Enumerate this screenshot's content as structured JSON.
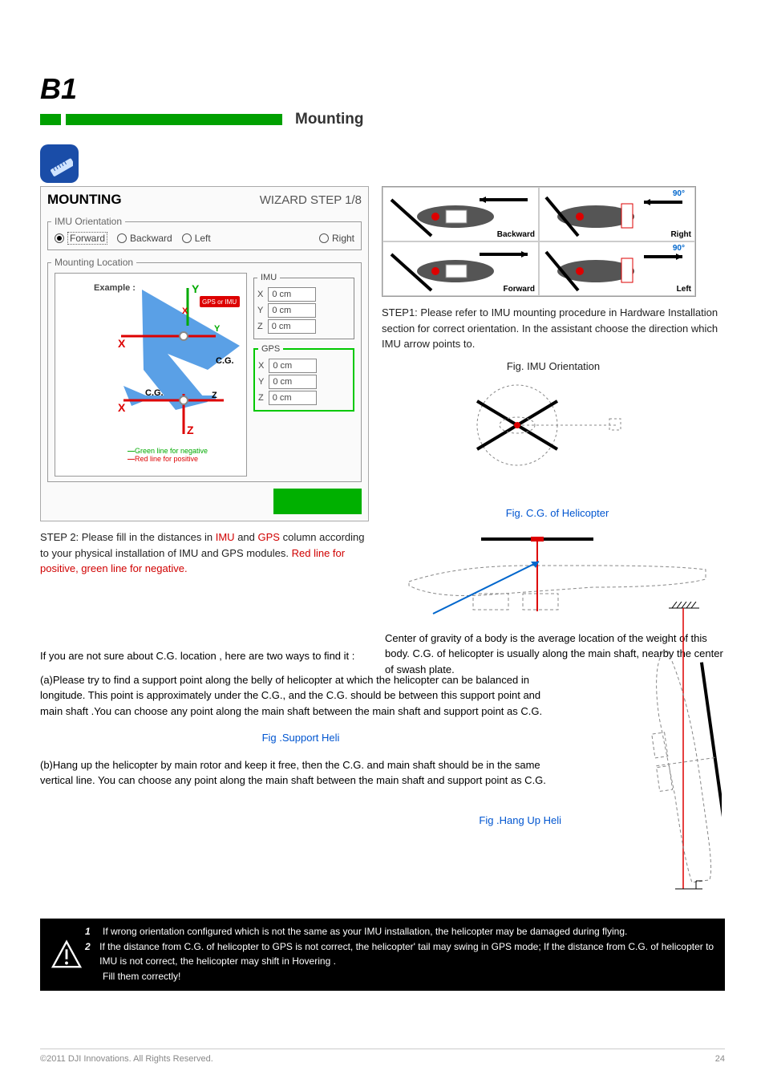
{
  "section": {
    "id": "B1",
    "title": "Mounting"
  },
  "mounting_panel": {
    "title": "MOUNTING",
    "wizard": "WIZARD STEP 1/8",
    "orientation_group": "IMU Orientation",
    "orientation_options": [
      "Forward",
      "Backward",
      "Left",
      "Right"
    ],
    "orientation_selected": "Forward",
    "location_group": "Mounting Location",
    "example": {
      "label": "Example :",
      "tag": "GPS or IMU",
      "cg": "C.G.",
      "neg_line": "Green line for negative",
      "pos_line": "Red line for positive"
    },
    "imu_group": "IMU",
    "gps_group": "GPS",
    "fields": {
      "x_label": "X",
      "x_val": "0 cm",
      "y_label": "Y",
      "y_val": "0 cm",
      "z_label": "Z",
      "z_val": "0 cm"
    }
  },
  "orientation_images": {
    "deg": "90°",
    "backward": "Backward",
    "right": "Right",
    "forward": "Forward",
    "left": "Left"
  },
  "step1": {
    "text": "STEP1: Please refer to IMU mounting procedure in Hardware Installation section for correct orientation. In the assistant choose the direction which IMU arrow points to.",
    "figure_caption": "Fig. IMU Orientation"
  },
  "step2": {
    "lead": "STEP 2: Please fill in the distances in",
    "imu_word": "IMU",
    "gps_word": "GPS",
    "tail": "column according to your physical installation of IMU and GPS modules.",
    "note": "Red line for positive, green line for negative.",
    "fig_cap_cg": "Fig. C.G. of Helicopter",
    "cg_para": "Center of gravity of a body is the average location of the weight of this body. C.G. of helicopter is usually along the main shaft, nearby the center of swash plate."
  },
  "support": {
    "title": "If you are not sure about C.G. location , here are two ways to find it :",
    "a": "(a)Please try to find a support point along the belly of helicopter at which the helicopter can be balanced in longitude. This point is approximately under the C.G., and the C.G. should be between this support point and main shaft .You can choose any point along the main shaft between the main shaft and support point as C.G.",
    "b": "(b)Hang up the helicopter by main rotor and keep it free, then the C.G. and main shaft should be in the same vertical line. You can choose any point along the main shaft between the main shaft and support point as C.G.",
    "fig_support": "Fig .Support Heli",
    "fig_hang": "Fig .Hang Up Heli"
  },
  "warning": {
    "row1": "If wrong orientation configured which is not the same as your IMU installation, the helicopter may be damaged during flying.",
    "row2_a": "If the distance from C.G. of helicopter to GPS is not correct, the helicopter' tail may swing in GPS mode; If the distance from C.G. of helicopter to IMU is not correct, the helicopter may shift in Hovering .",
    "row2_b": "Fill them correctly!"
  },
  "footer": {
    "copyright": "©2011 DJI Innovations. All Rights Reserved.",
    "page": "24"
  }
}
